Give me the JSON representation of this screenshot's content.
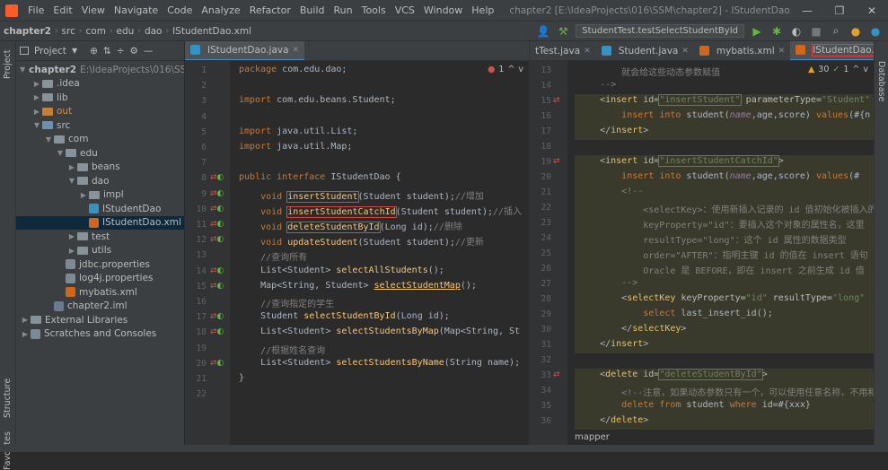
{
  "menubar": {
    "items": [
      "File",
      "Edit",
      "View",
      "Navigate",
      "Code",
      "Analyze",
      "Refactor",
      "Build",
      "Run",
      "Tools",
      "VCS",
      "Window",
      "Help"
    ],
    "title": "chapter2 [E:\\IdeaProjects\\016\\SSM\\chapter2] - IStudentDao.java"
  },
  "navbar": {
    "crumbs": [
      "chapter2",
      "src",
      "com",
      "edu",
      "dao",
      "IStudentDao.xml"
    ],
    "run_config": "StudentTest.testSelectStudentById"
  },
  "sidebar": {
    "strip_labels": [
      "Project",
      "Structure",
      "Favorites"
    ],
    "header": "Project",
    "tree": [
      {
        "label": "chapter2",
        "extra": "E:\\IdeaProjects\\016\\SSM",
        "indent": 0,
        "icon": "folder-blue",
        "arrow": "v"
      },
      {
        "label": ".idea",
        "indent": 1,
        "icon": "folder",
        "arrow": ">"
      },
      {
        "label": "lib",
        "indent": 1,
        "icon": "folder",
        "arrow": ">"
      },
      {
        "label": "out",
        "indent": 1,
        "icon": "folder-orange",
        "arrow": ">"
      },
      {
        "label": "src",
        "indent": 1,
        "icon": "folder-blue",
        "arrow": "v"
      },
      {
        "label": "com",
        "indent": 2,
        "icon": "folder",
        "arrow": "v"
      },
      {
        "label": "edu",
        "indent": 3,
        "icon": "folder",
        "arrow": "v"
      },
      {
        "label": "beans",
        "indent": 4,
        "icon": "folder",
        "arrow": ">"
      },
      {
        "label": "dao",
        "indent": 4,
        "icon": "folder",
        "arrow": "v"
      },
      {
        "label": "impl",
        "indent": 5,
        "icon": "folder",
        "arrow": ">"
      },
      {
        "label": "IStudentDao",
        "indent": 5,
        "icon": "java",
        "arrow": ""
      },
      {
        "label": "IStudentDao.xml",
        "indent": 5,
        "icon": "xml",
        "arrow": "",
        "selected": true
      },
      {
        "label": "test",
        "indent": 4,
        "icon": "folder",
        "arrow": ">"
      },
      {
        "label": "utils",
        "indent": 4,
        "icon": "folder",
        "arrow": ">"
      },
      {
        "label": "jdbc.properties",
        "indent": 3,
        "icon": "prop",
        "arrow": ""
      },
      {
        "label": "log4j.properties",
        "indent": 3,
        "icon": "prop",
        "arrow": ""
      },
      {
        "label": "mybatis.xml",
        "indent": 3,
        "icon": "xml",
        "arrow": ""
      },
      {
        "label": "chapter2.iml",
        "indent": 2,
        "icon": "iml",
        "arrow": ""
      },
      {
        "label": "External Libraries",
        "indent": 0,
        "icon": "lib",
        "arrow": ">"
      },
      {
        "label": "Scratches and Consoles",
        "indent": 0,
        "icon": "scratch",
        "arrow": ">"
      }
    ]
  },
  "editor_left": {
    "tab": "IStudentDao.java",
    "error_count": "1",
    "lines": [
      {
        "n": "1",
        "html": "<span class=\"kw\">package</span> com.edu.dao;"
      },
      {
        "n": "2",
        "html": ""
      },
      {
        "n": "3",
        "html": "<span class=\"kw\">import</span> com.edu.beans.Student;"
      },
      {
        "n": "4",
        "html": ""
      },
      {
        "n": "5",
        "html": "<span class=\"kw\">import</span> java.util.List;"
      },
      {
        "n": "6",
        "html": "<span class=\"kw\">import</span> java.util.Map;"
      },
      {
        "n": "7",
        "html": ""
      },
      {
        "n": "8",
        "html": "<span class=\"kw\">public interface</span> IStudentDao {"
      },
      {
        "n": "9",
        "html": "    <span class=\"kw\">void</span> <span class=\"fn hl\">insertStudent</span>(Student student);<span class=\"cm\">//增加</span>"
      },
      {
        "n": "10",
        "html": "    <span class=\"kw\">void</span> <span class=\"fn hl\">insertStudentCatchId</span>(Student student);<span class=\"cm\">//插入</span>"
      },
      {
        "n": "11",
        "html": "    <span class=\"kw\">void</span> <span class=\"fn hl\">deleteStudentById</span>(Long id);<span class=\"cm\">//删除</span>"
      },
      {
        "n": "12",
        "html": "    <span class=\"kw\">void</span> <span class=\"fn\">updateStudent</span>(Student student);<span class=\"cm\">//更新</span>"
      },
      {
        "n": "13",
        "html": "    <span class=\"cm\">//查询所有</span>"
      },
      {
        "n": "14",
        "html": "    List&lt;Student&gt; <span class=\"fn\">selectAllStudents</span>();"
      },
      {
        "n": "15",
        "html": "    Map&lt;String, Student&gt; <span class=\"ulfn\">selectStudentMap</span>();"
      },
      {
        "n": "16",
        "html": "    <span class=\"cm\">//查询指定的学生</span>"
      },
      {
        "n": "17",
        "html": "    Student <span class=\"fn\">selectStudentById</span>(Long id);"
      },
      {
        "n": "18",
        "html": "    List&lt;Student&gt; <span class=\"fn\">selectStudentsByMap</span>(Map&lt;String, St"
      },
      {
        "n": "19",
        "html": "    <span class=\"cm\">//根据姓名查询</span>"
      },
      {
        "n": "20",
        "html": "    List&lt;Student&gt; <span class=\"fn\">selectStudentsByName</span>(String name);"
      },
      {
        "n": "21",
        "html": "}"
      },
      {
        "n": "22",
        "html": ""
      }
    ]
  },
  "editor_right": {
    "tabs": [
      "tTest.java",
      "Student.java",
      "mybatis.xml",
      "IStudentDao.xml"
    ],
    "warn_count": "30",
    "ok_count": "1",
    "breadcrumb": "mapper",
    "lines": [
      {
        "n": "13",
        "html": "<span class=\"cm\">        就会给这些动态参数赋值</span>"
      },
      {
        "n": "14",
        "html": "<span class=\"cm\">    --&gt;</span>"
      },
      {
        "n": "15",
        "html": "    &lt;<span class=\"tag\">insert</span> <span class=\"attr\">id=</span><span class=\"str hl\">\"insertStudent\"</span> <span class=\"attr\">parameterType=</span><span class=\"str\">\"Student\"</span>"
      },
      {
        "n": "16",
        "html": "        <span class=\"kw\">insert into</span> student(<span class=\"ital\">name</span>,age,score) <span class=\"kw\">values</span>(#{n"
      },
      {
        "n": "17",
        "html": "    &lt;/<span class=\"tag\">insert</span>&gt;"
      },
      {
        "n": "18",
        "html": ""
      },
      {
        "n": "19",
        "html": "    &lt;<span class=\"tag\">insert</span> <span class=\"attr\">id=</span><span class=\"str hl\">\"insertStudentCatchId\"</span>&gt;"
      },
      {
        "n": "20",
        "html": "        <span class=\"kw\">insert into</span> student(<span class=\"ital\">name</span>,age,score) <span class=\"kw\">values</span>(#"
      },
      {
        "n": "21",
        "html": "<span class=\"cm\">        &lt;!--</span>"
      },
      {
        "n": "22",
        "html": "<span class=\"cm\">            &lt;selectKey&gt;：使用新插入记录的 id 值初始化被插入的</span>"
      },
      {
        "n": "23",
        "html": "<span class=\"cm\">            keyProperty=\"id\"：要插入这个对象的属性名，这里</span>"
      },
      {
        "n": "24",
        "html": "<span class=\"cm\">            resultType=\"long\"：这个 id 属性的数据类型</span>"
      },
      {
        "n": "25",
        "html": "<span class=\"cm\">            order=\"AFTER\"：指明主键 id 的值在 insert 语句</span>"
      },
      {
        "n": "26",
        "html": "<span class=\"cm\">            Oracle 是 BEFORE，即在 insert 之前生成 id 值</span>"
      },
      {
        "n": "27",
        "html": "<span class=\"cm\">        --&gt;</span>"
      },
      {
        "n": "28",
        "html": "        &lt;<span class=\"tag\">selectKey</span> <span class=\"attr\">keyProperty=</span><span class=\"str\">\"id\"</span> <span class=\"attr\">resultType=</span><span class=\"str\">\"long\"</span>"
      },
      {
        "n": "29",
        "html": "            <span class=\"kw\">select</span> last_insert_id();"
      },
      {
        "n": "30",
        "html": "        &lt;/<span class=\"tag\">selectKey</span>&gt;"
      },
      {
        "n": "31",
        "html": "    &lt;/<span class=\"tag\">insert</span>&gt;"
      },
      {
        "n": "32",
        "html": ""
      },
      {
        "n": "33",
        "html": "    &lt;<span class=\"tag\">delete</span> <span class=\"attr\">id=</span><span class=\"str hl\">\"deleteStudentById\"</span>&gt;"
      },
      {
        "n": "34",
        "html": "<span class=\"cm\">        &lt;!--注意，如果动态参数只有一个，可以使用任意名称，不用和</span>"
      },
      {
        "n": "35",
        "html": "        <span class=\"kw\">delete from</span> student <span class=\"kw\">where</span> id=#{xxx}"
      },
      {
        "n": "36",
        "html": "    &lt;/<span class=\"tag\">delete</span>&gt;"
      }
    ]
  },
  "right_strip_label": "Database"
}
